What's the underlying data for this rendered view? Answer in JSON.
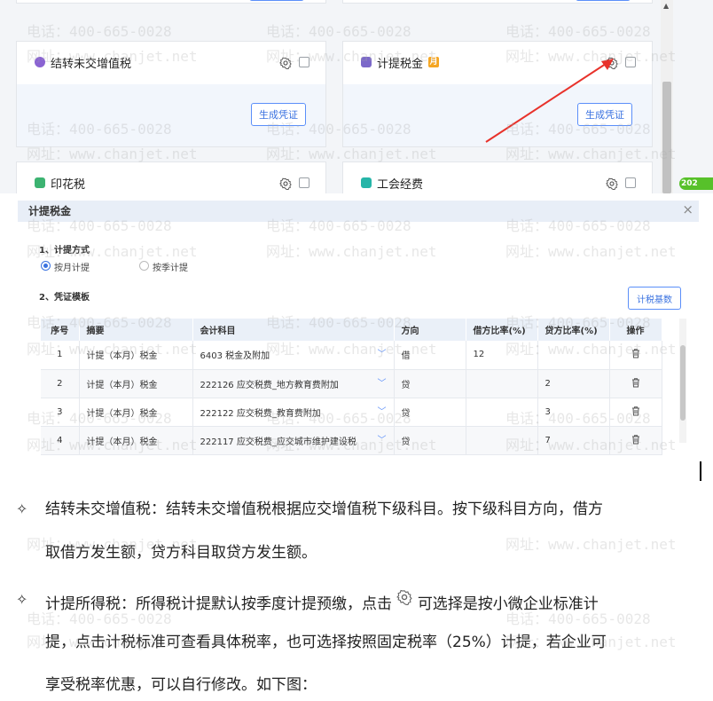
{
  "cards": {
    "top_partial_buttons": [
      "",
      ""
    ],
    "items": [
      {
        "title": "结转未交增值税",
        "icon_color": "#8a63d2",
        "button": "生成凭证"
      },
      {
        "title": "计提税金",
        "icon_color": "#7b68c9",
        "badge": "月",
        "button": "生成凭证"
      },
      {
        "title": "印花税",
        "icon_color": "#3cb371"
      },
      {
        "title": "工会经费",
        "icon_color": "#26b5a8"
      }
    ],
    "side_tag": "202"
  },
  "dialog": {
    "title": "计提税金",
    "close": "×",
    "section1": "1、计提方式",
    "options": [
      "按月计提",
      "按季计提"
    ],
    "selected_option": 0,
    "section2": "2、凭证模板",
    "std_button": "计税基数",
    "table": {
      "headers": [
        "序号",
        "摘要",
        "会计科目",
        "方向",
        "借方比率(%)",
        "贷方比率(%)",
        "操作"
      ],
      "rows": [
        {
          "no": "1",
          "summary": "计提（本月）税金",
          "account": "6403 税金及附加",
          "dir": "借",
          "debit": "12",
          "credit": ""
        },
        {
          "no": "2",
          "summary": "计提（本月）税金",
          "account": "222126 应交税费_地方教育费附加",
          "dir": "贷",
          "debit": "",
          "credit": "2"
        },
        {
          "no": "3",
          "summary": "计提（本月）税金",
          "account": "222122 应交税费_教育费附加",
          "dir": "贷",
          "debit": "",
          "credit": "3"
        },
        {
          "no": "4",
          "summary": "计提（本月）税金",
          "account": "222117 应交税费_应交城市维护建设税",
          "dir": "贷",
          "debit": "",
          "credit": "7"
        }
      ]
    }
  },
  "paragraphs": {
    "bullet": "✧",
    "p1_line1": "结转未交增值税：结转未交增值税根据应交增值税下级科目。按下级科目方向，借方",
    "p1_line2": "取借方发生额，贷方科目取贷方发生额。",
    "p2_line1_a": "计提所得税：所得税计提默认按季度计提预缴，点击",
    "p2_line1_b": "可选择是按小微企业标准计",
    "p2_line2": "提，点击计税标准可查看具体税率，也可选择按照固定税率（25%）计提，若企业可",
    "p2_line3": "享受税率优惠，可以自行修改。如下图："
  },
  "watermark": {
    "phone": "电话：400-665-0028",
    "site": "网址：www.chanjet.net"
  }
}
